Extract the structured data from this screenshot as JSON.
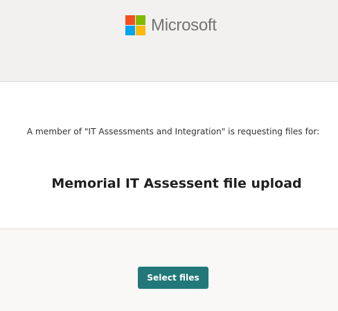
{
  "header": {
    "brand_name": "Microsoft",
    "logo_colors": [
      "#f25022",
      "#7fba00",
      "#00a4ef",
      "#ffb900"
    ]
  },
  "content": {
    "request_text": "A member of \"IT Assessments and Integration\" is requesting files for:",
    "title": "Memorial IT Assessent file upload"
  },
  "footer": {
    "select_files_label": "Select files"
  },
  "colors": {
    "accent": "#227878",
    "header_bg": "#f2f1f0",
    "content_bg": "#ffffff"
  }
}
